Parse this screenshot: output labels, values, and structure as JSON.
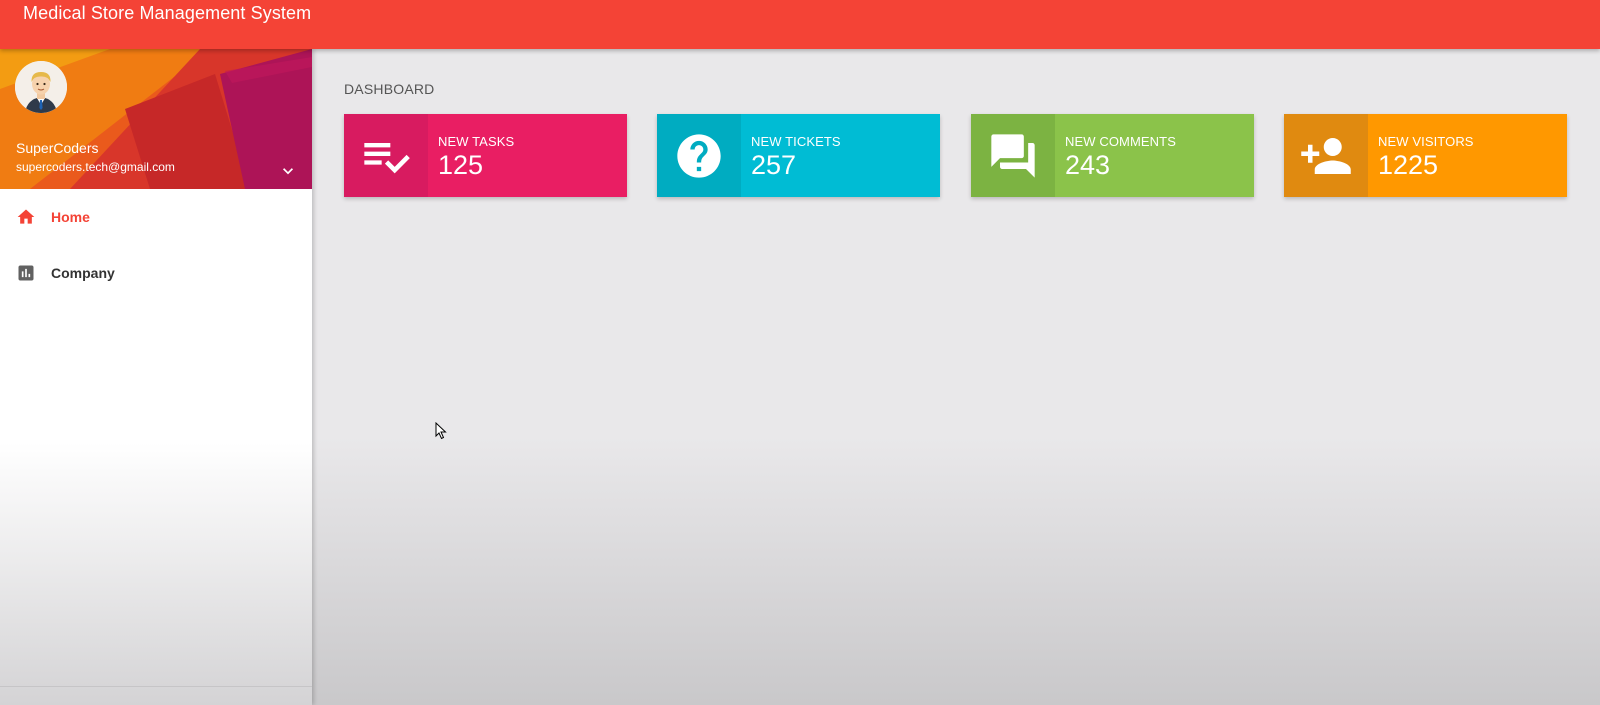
{
  "app": {
    "title": "Medical Store Management System",
    "accent_color": "#f44336"
  },
  "user": {
    "name": "SuperCoders",
    "email": "supercoders.tech@gmail.com",
    "avatar_icon": "user-avatar",
    "menu_toggle_icon": "chevron-down-icon"
  },
  "sidebar": {
    "items": [
      {
        "label": "Home",
        "icon": "home-icon",
        "active": true
      },
      {
        "label": "Company",
        "icon": "bar-chart-icon",
        "active": false
      }
    ]
  },
  "dashboard": {
    "title": "DASHBOARD",
    "cards": [
      {
        "label": "NEW TASKS",
        "value": "125",
        "icon": "playlist-check-icon",
        "color": "#e91e63"
      },
      {
        "label": "NEW TICKETS",
        "value": "257",
        "icon": "help-icon",
        "color": "#00bcd4"
      },
      {
        "label": "NEW COMMENTS",
        "value": "243",
        "icon": "forum-icon",
        "color": "#8bc34a"
      },
      {
        "label": "NEW VISITORS",
        "value": "1225",
        "icon": "person-add-icon",
        "color": "#ff9800"
      }
    ]
  }
}
